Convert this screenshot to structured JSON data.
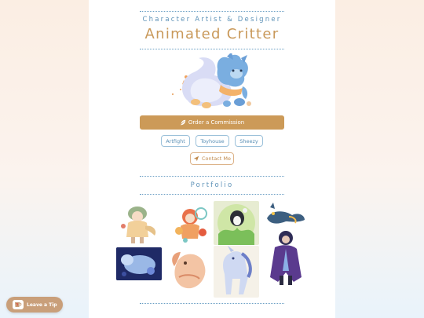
{
  "header": {
    "subtitle": "Character Artist & Designer",
    "title": "Animated Critter"
  },
  "actions": {
    "commission_label": "Order a Commission",
    "contact_label": "Contact Me"
  },
  "links": [
    {
      "label": "Artfight"
    },
    {
      "label": "Toyhouse"
    },
    {
      "label": "Sheezy"
    }
  ],
  "portfolio": {
    "heading": "Portfolio"
  },
  "tip": {
    "label": "Leave a Tip"
  },
  "icons": {
    "commission": "feather-icon",
    "contact": "paper-plane-icon",
    "tip": "coffee-cup-icon"
  },
  "colors": {
    "accent_gold": "#cc9a58",
    "accent_blue": "#5f93b8",
    "tip_button": "#c99f7a"
  }
}
